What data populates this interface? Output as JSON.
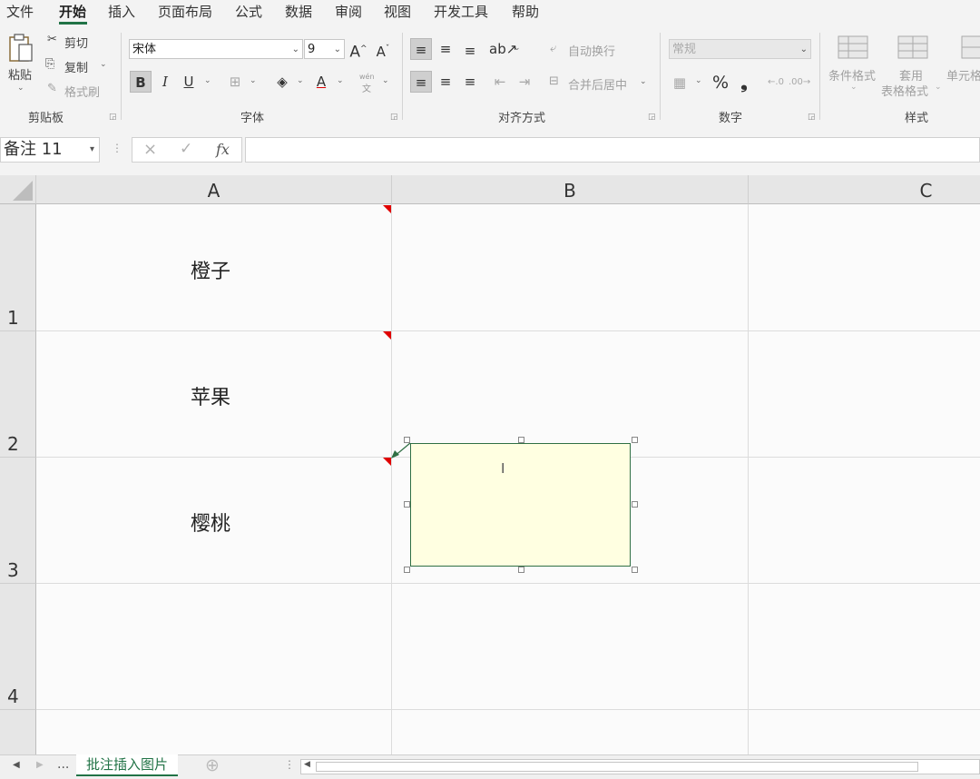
{
  "menu": {
    "items": [
      "文件",
      "开始",
      "插入",
      "页面布局",
      "公式",
      "数据",
      "审阅",
      "视图",
      "开发工具",
      "帮助"
    ],
    "active": "开始"
  },
  "ribbon": {
    "clipboard": {
      "paste_label": "粘贴",
      "cut_label": "剪切",
      "copy_label": "复制",
      "format_painter_label": "格式刷",
      "group_label": "剪贴板"
    },
    "font": {
      "font_name": "宋体",
      "font_size": "9",
      "bold": "B",
      "italic": "I",
      "underline": "U",
      "phonetic_top": "wén",
      "phonetic_bottom": "文",
      "group_label": "字体"
    },
    "alignment": {
      "wrap_text_label": "自动换行",
      "merge_center_label": "合并后居中",
      "group_label": "对齐方式"
    },
    "number": {
      "format_value": "常规",
      "percent": "%",
      "comma": "❟",
      "group_label": "数字"
    },
    "styles": {
      "conditional_format_label": "条件格式",
      "table_format_label_1": "套用",
      "table_format_label_2": "表格格式",
      "cell_styles_label": "单元格",
      "group_label": "样式"
    }
  },
  "formula_bar": {
    "name_box": "备注 11",
    "cancel_icon": "×",
    "enter_icon": "✓",
    "fx_label": "fx",
    "value": ""
  },
  "grid": {
    "columns": [
      "A",
      "B",
      "C"
    ],
    "rows": [
      "1",
      "2",
      "3",
      "4"
    ],
    "cells": {
      "A1": "橙子",
      "A2": "苹果",
      "A3": "樱桃"
    }
  },
  "comment": {
    "text": "",
    "background": "#ffffe1",
    "border": "#2f6f44",
    "marker_color": "#e00000"
  },
  "sheets": {
    "ellipsis": "...",
    "tabs": [
      "批注插入图片"
    ],
    "active": "批注插入图片",
    "add_icon": "⊕"
  },
  "colors": {
    "accent": "#217346"
  }
}
